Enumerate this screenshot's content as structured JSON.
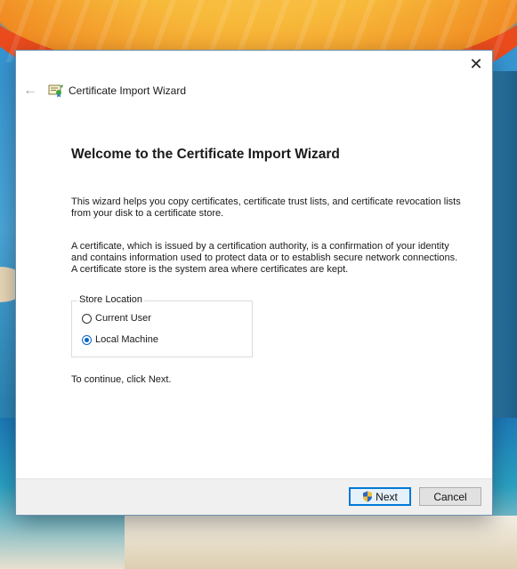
{
  "dialog": {
    "close_symbol": "✕",
    "back_symbol": "←",
    "title": "Certificate Import Wizard",
    "heading": "Welcome to the Certificate Import Wizard",
    "paragraph1": "This wizard helps you copy certificates, certificate trust lists, and certificate revocation lists from your disk to a certificate store.",
    "paragraph2": "A certificate, which is issued by a certification authority, is a confirmation of your identity and contains information used to protect data or to establish secure network connections. A certificate store is the system area where certificates are kept.",
    "store_location": {
      "legend": "Store Location",
      "options": [
        {
          "label": "Current User",
          "checked": false
        },
        {
          "label": "Local Machine",
          "checked": true
        }
      ]
    },
    "continue_text": "To continue, click Next.",
    "buttons": {
      "next": "Next",
      "cancel": "Cancel"
    }
  },
  "colors": {
    "accent": "#0078d7",
    "radio_selected": "#0a64c8",
    "footer_bg": "#f0f0f0"
  },
  "icons": {
    "back": "back-arrow-icon",
    "certificate": "certificate-icon",
    "shield": "uac-shield-icon",
    "close": "close-icon"
  }
}
